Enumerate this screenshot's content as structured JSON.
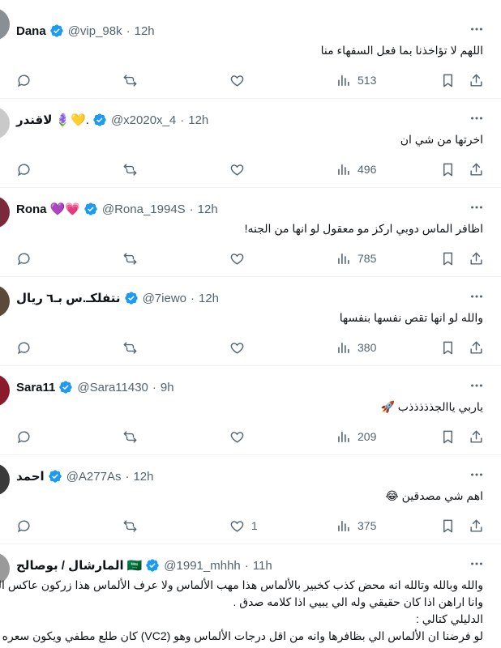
{
  "colors": {
    "verified": "#1d9bf0",
    "muted": "#536471",
    "divider": "#eff3f4"
  },
  "tweets": [
    {
      "name": "Dana",
      "emoji": "",
      "handle": "@vip_98k",
      "time": "12h",
      "text": "اللهم لا تؤاخذنا بما فعل السفهاء منا",
      "replies": "",
      "retweets": "",
      "likes": "",
      "views": "513",
      "avatar_color": "#8a8f94"
    },
    {
      "name": "لاقندر",
      "emoji": "🪻💛.",
      "handle": "@x2020x_4",
      "time": "12h",
      "text": "اخرتها من شي ان",
      "replies": "",
      "retweets": "",
      "likes": "",
      "views": "496",
      "avatar_color": "#c9c9c9"
    },
    {
      "name": "Rona",
      "emoji": "💜💗",
      "handle": "@Rona_1994S",
      "time": "12h",
      "text": "اظافر الماس دوبي اركز  مو معقول لو انها من الجنه!",
      "replies": "",
      "retweets": "",
      "likes": "",
      "views": "785",
      "avatar_color": "#7a2a3a"
    },
    {
      "name": "نتفلكـ.س بـ٦ ريال",
      "emoji": "",
      "handle": "@7iewo",
      "time": "12h",
      "text": "والله لو انها تقص نفسها بنفسها",
      "replies": "",
      "retweets": "",
      "likes": "",
      "views": "380",
      "avatar_color": "#5b4a3a"
    },
    {
      "name": "Sara11",
      "emoji": "",
      "handle": "@Sara11430",
      "time": "9h",
      "text": "ياربي ياالجذذذذذب 🚀",
      "replies": "",
      "retweets": "",
      "likes": "",
      "views": "209",
      "avatar_color": "#8b1a2a"
    },
    {
      "name": "احمد",
      "emoji": "",
      "handle": "@A277As",
      "time": "12h",
      "text": "اهم شي مصدقين 😂",
      "replies": "",
      "retweets": "",
      "likes": "1",
      "views": "375",
      "avatar_color": "#3a3a3a"
    }
  ],
  "last_tweet": {
    "name": "المارشال / بوصالح",
    "emoji": "🇸🇦",
    "handle": "@1991_mhhh",
    "time": "11h",
    "lines": [
      "والله وبالله وتالله انه محض كذب كخبير بالألماس هذا مهب الألماس ولا عرف الألماس هذا زركون عاكس الون .",
      "وانا اراهن اذا كان حقيقي وله الي يبيي اذا كلامه صدق .",
      "الدليلي كتالي :",
      "لو فرضنا ان الألماس الي بظافرها وانه من اقل درجات الألماس وهو (VC2) كان طلع مطفي ويكون سعره اكثر"
    ],
    "avatar_color": "#9a9a9a"
  }
}
